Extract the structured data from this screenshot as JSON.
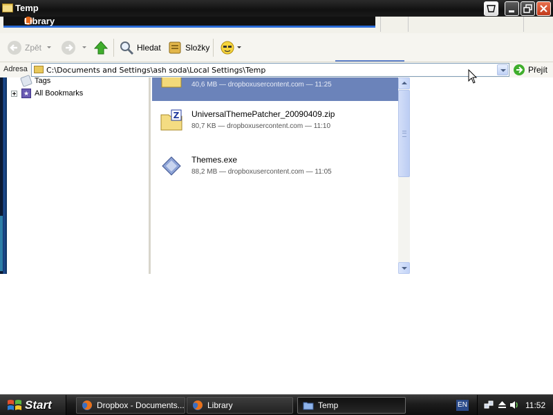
{
  "window": {
    "title": "Temp",
    "background_window_title": "Library"
  },
  "toolbar": {
    "back_label": "Zpět",
    "search_label": "Hledat",
    "folders_label": "Složky"
  },
  "address": {
    "label": "Adresa",
    "value": "C:\\Documents and Settings\\ash soda\\Local Settings\\Temp",
    "go_label": "Přejít"
  },
  "sidebar": {
    "items": [
      {
        "label": "Tags",
        "icon": "tag-icon",
        "expandable": false
      },
      {
        "label": "All Bookmarks",
        "icon": "bookmarks-star-icon",
        "expandable": true
      }
    ]
  },
  "downloads": [
    {
      "name": "",
      "meta": "40,6 MB — dropboxusercontent.com — 11:25",
      "icon": "folder-icon",
      "selected": true
    },
    {
      "name": "UniversalThemePatcher_20090409.zip",
      "meta": "80,7 KB — dropboxusercontent.com — 11:10",
      "icon": "zip-icon",
      "selected": false
    },
    {
      "name": "Themes.exe",
      "meta": "88,2 MB — dropboxusercontent.com — 11:05",
      "icon": "exe-icon",
      "selected": false
    }
  ],
  "taskbar": {
    "start_label": "Start",
    "tasks": [
      {
        "label": "Dropbox - Documents...",
        "icon": "firefox-icon",
        "active": false
      },
      {
        "label": "Library",
        "icon": "firefox-icon",
        "active": false
      },
      {
        "label": "Temp",
        "icon": "folder-icon",
        "active": true
      }
    ],
    "language": "EN",
    "clock": "11:52"
  },
  "colors": {
    "selection": "#6b83ba",
    "titlebar": "#111111",
    "address_border": "#7f9db9"
  }
}
